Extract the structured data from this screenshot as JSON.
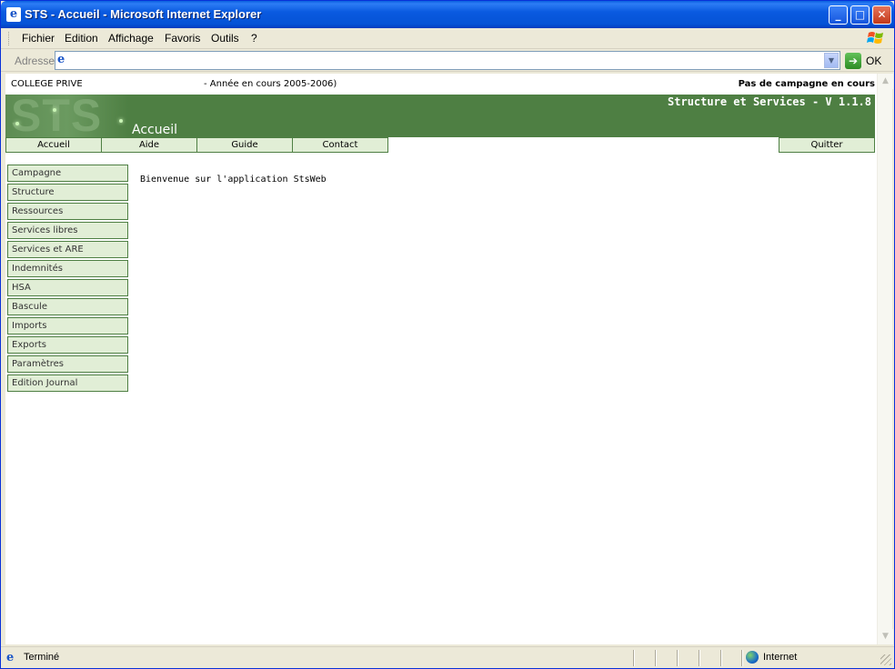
{
  "window": {
    "title": "STS - Accueil - Microsoft Internet Explorer",
    "icon": "ie-icon"
  },
  "menu": {
    "items": [
      "Fichier",
      "Edition",
      "Affichage",
      "Favoris",
      "Outils",
      "?"
    ]
  },
  "address": {
    "label": "Adresse",
    "value": "",
    "go_label": "OK"
  },
  "header": {
    "school": "COLLEGE PRIVE",
    "year": "- Année en cours 2005-2006)",
    "campaign_status": "Pas de campagne en cours",
    "logo_text": "STS",
    "app_title": "Structure et Services - V 1.1.8",
    "page_title": "Accueil"
  },
  "topnav": {
    "items": [
      "Accueil",
      "Aide",
      "Guide",
      "Contact"
    ],
    "quit": "Quitter"
  },
  "sidenav": {
    "items": [
      "Campagne",
      "Structure",
      "Ressources",
      "Services libres",
      "Services et ARE",
      "Indemnités",
      "HSA",
      "Bascule",
      "Imports",
      "Exports",
      "Paramètres",
      "Edition Journal"
    ]
  },
  "main": {
    "welcome": "Bienvenue sur l'application StsWeb"
  },
  "status": {
    "text": "Terminé",
    "zone": "Internet"
  },
  "colors": {
    "banner": "#4e7f43",
    "nav_bg": "#e1eed6",
    "titlebar": "#0553d6"
  }
}
